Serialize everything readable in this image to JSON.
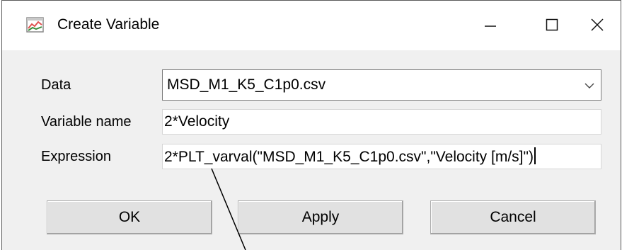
{
  "window": {
    "title": "Create Variable",
    "controls": {
      "minimize_icon": "minimize-icon",
      "maximize_icon": "maximize-icon",
      "close_icon": "close-icon"
    }
  },
  "form": {
    "data": {
      "label": "Data",
      "selected": "MSD_M1_K5_C1p0.csv"
    },
    "variable_name": {
      "label": "Variable name",
      "value": "2*Velocity"
    },
    "expression": {
      "label": "Expression",
      "value": "2*PLT_varval(\"MSD_M1_K5_C1p0.csv\",\"Velocity [m/s]\")"
    }
  },
  "buttons": {
    "ok": "OK",
    "apply": "Apply",
    "cancel": "Cancel"
  },
  "colors": {
    "dialog_bg": "#f0f0f0",
    "titlebar_bg": "#ffffff",
    "button_bg": "#e1e1e1"
  }
}
